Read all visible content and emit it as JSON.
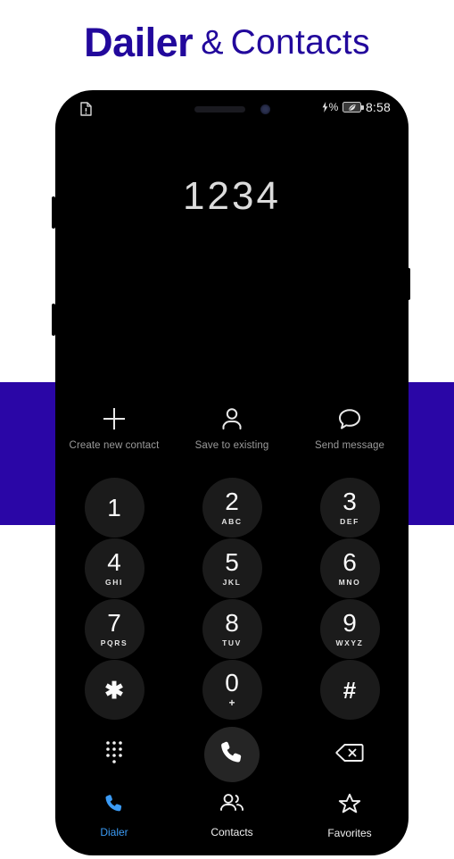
{
  "header": {
    "title_bold": "Dailer",
    "title_amp": "&",
    "title_light": "Contacts",
    "title_color": "#22089c",
    "band_color": "#2a06a6"
  },
  "status_bar": {
    "sim_icon": "sim-alert-icon",
    "speaker_icon": "earpiece-speaker",
    "camera_icon": "front-camera-dot",
    "battery_percent_symbol": "%",
    "battery_icon": "battery-eco-icon",
    "time": "8:58"
  },
  "dialer": {
    "number": "1234",
    "actions": [
      {
        "id": "create-new-contact",
        "icon": "plus-icon",
        "label": "Create new contact"
      },
      {
        "id": "save-to-existing",
        "icon": "person-icon",
        "label": "Save to existing"
      },
      {
        "id": "send-message",
        "icon": "message-bubble-icon",
        "label": "Send message"
      }
    ],
    "keys": [
      {
        "digit": "1",
        "letters": ""
      },
      {
        "digit": "2",
        "letters": "ABC"
      },
      {
        "digit": "3",
        "letters": "DEF"
      },
      {
        "digit": "4",
        "letters": "GHI"
      },
      {
        "digit": "5",
        "letters": "JKL"
      },
      {
        "digit": "6",
        "letters": "MNO"
      },
      {
        "digit": "7",
        "letters": "PQRS"
      },
      {
        "digit": "8",
        "letters": "TUV"
      },
      {
        "digit": "9",
        "letters": "WXYZ"
      },
      {
        "digit": "✱",
        "letters": ""
      },
      {
        "digit": "0",
        "letters": "+"
      },
      {
        "digit": "#",
        "letters": ""
      }
    ],
    "call_row": {
      "keypad_toggle_icon": "dialpad-dots-icon",
      "call_icon": "phone-handset-icon",
      "call_button_color": "#252525",
      "backspace_icon": "backspace-icon"
    }
  },
  "bottom_nav": {
    "active_color": "#3b9bf5",
    "items": [
      {
        "id": "dialer",
        "icon": "phone-handset-icon",
        "label": "Dialer",
        "active": true
      },
      {
        "id": "contacts",
        "icon": "people-icon",
        "label": "Contacts",
        "active": false
      },
      {
        "id": "favorites",
        "icon": "star-outline-icon",
        "label": "Favorites",
        "active": false
      }
    ]
  }
}
